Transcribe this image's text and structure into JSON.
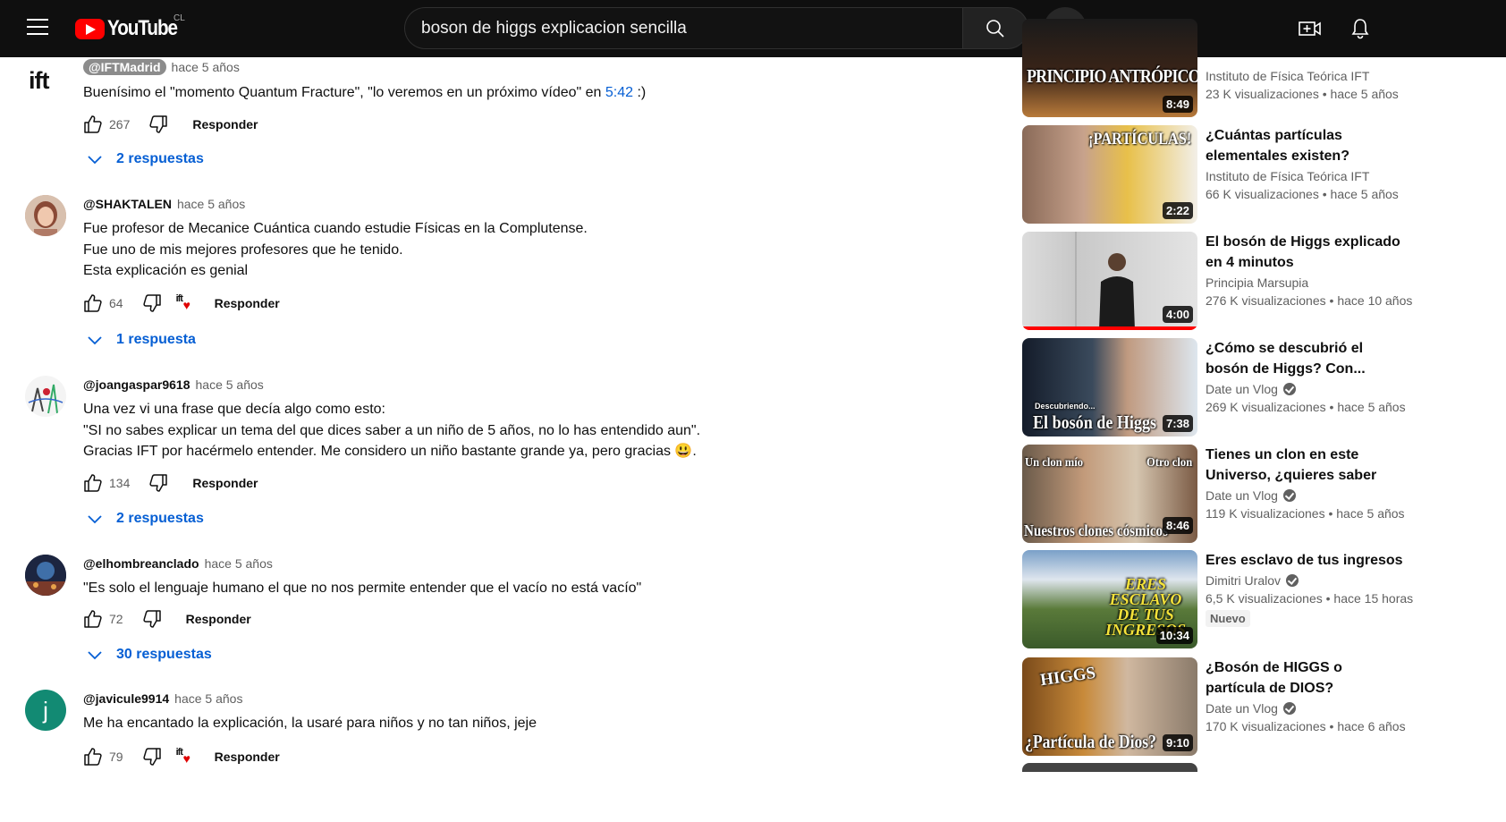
{
  "header": {
    "region_code": "CL",
    "logo_text": "YouTube",
    "search_value": "boson de higgs explicacion sencilla"
  },
  "comments": [
    {
      "author": "@IFTMadrid",
      "time": "hace 5 años",
      "text_before_link": "Buenísimo el \"momento Quantum Fracture\",  \"lo veremos en un próximo vídeo\" en ",
      "timestamp_link": "5:42",
      "text_after_link": " :)",
      "likes": "267",
      "reply_label": "Responder",
      "replies": "2 respuestas"
    },
    {
      "author": "@SHAKTALEN",
      "time": "hace 5 años",
      "lines": [
        "Fue profesor de Mecanice Cuántica cuando estudie Físicas en la Complutense.",
        "Fue uno de mis mejores profesores que he tenido.",
        "Esta explicación es genial"
      ],
      "likes": "64",
      "creator_heart": "ift",
      "reply_label": "Responder",
      "replies": "1 respuesta"
    },
    {
      "author": "@joangaspar9618",
      "time": "hace 5 años",
      "lines": [
        "Una vez vi una frase que decía algo como esto:",
        "\"SI no sabes explicar un tema del que dices saber a un niño de 5 años, no lo has entendido aun\".",
        "Gracias IFT por hacérmelo entender. Me considero un niño bastante grande ya, pero gracias 😃."
      ],
      "likes": "134",
      "reply_label": "Responder",
      "replies": "2 respuestas"
    },
    {
      "author": "@elhombreanclado",
      "time": "hace 5 años",
      "lines": [
        "\"Es solo el lenguaje humano el que no nos permite entender que el vacío no está vacío\""
      ],
      "likes": "72",
      "reply_label": "Responder",
      "replies": "30 respuestas"
    },
    {
      "author": "@javicule9914",
      "avatar_letter": "j",
      "time": "hace 5 años",
      "lines": [
        "Me ha encantado la explicación, la usaré para niños y no tan niños, jeje"
      ],
      "likes": "79",
      "creator_heart": "ift",
      "reply_label": "Responder"
    }
  ],
  "sidebar": [
    {
      "thumb_text": "PRINCIPIO ANTRÓPICO",
      "duration": "8:49",
      "channel": "Instituto de Física Teórica IFT",
      "stats": "23 K visualizaciones  • hace 5 años"
    },
    {
      "thumb_text": "¡PARTÍCULAS!",
      "duration": "2:22",
      "title": "¿Cuántas partículas elementales existen?",
      "channel": "Instituto de Física Teórica IFT",
      "stats": "66 K visualizaciones  • hace 5 años"
    },
    {
      "duration": "4:00",
      "title": "El bosón de Higgs explicado en 4 minutos",
      "channel": "Principia Marsupia",
      "stats": "276 K visualizaciones  • hace 10 años",
      "watched_fraction": 1.0
    },
    {
      "thumb_text": "El bosón de Higgs",
      "thumb_small": "Descubriendo...",
      "duration": "7:38",
      "title": "¿Cómo se descubrió el bosón de Higgs? Con...",
      "channel": "Date un Vlog",
      "stats": "269 K visualizaciones  • hace 5 años"
    },
    {
      "thumb_text_left": "Un clon mío",
      "thumb_text_right": "Otro clon",
      "thumb_text": "Nuestros clones cósmicos",
      "duration": "8:46",
      "title": "Tienes un clon en este Universo, ¿quieres saber dónde?",
      "channel": "Date un Vlog",
      "stats": "119 K visualizaciones  • hace 5 años"
    },
    {
      "thumb_text": "ERES ESCLAVO DE TUS INGRESOS",
      "duration": "10:34",
      "title": "Eres esclavo de tus ingresos",
      "channel": "Dimitri Uralov",
      "stats": "6,5 K visualizaciones  • hace 15 horas",
      "badge": "Nuevo"
    },
    {
      "thumb_text_top": "HIGGS",
      "thumb_text": "¿Partícula de Dios?",
      "duration": "9:10",
      "title": "¿Bosón de HIGGS o partícula de DIOS?",
      "channel": "Date un Vlog",
      "stats": "170 K visualizaciones  • hace 6 años"
    }
  ],
  "colors": {
    "topbar": "#0f0f0f",
    "brand_red": "#ff0000",
    "link_blue": "#065fd4",
    "secondary_text": "#606060"
  }
}
